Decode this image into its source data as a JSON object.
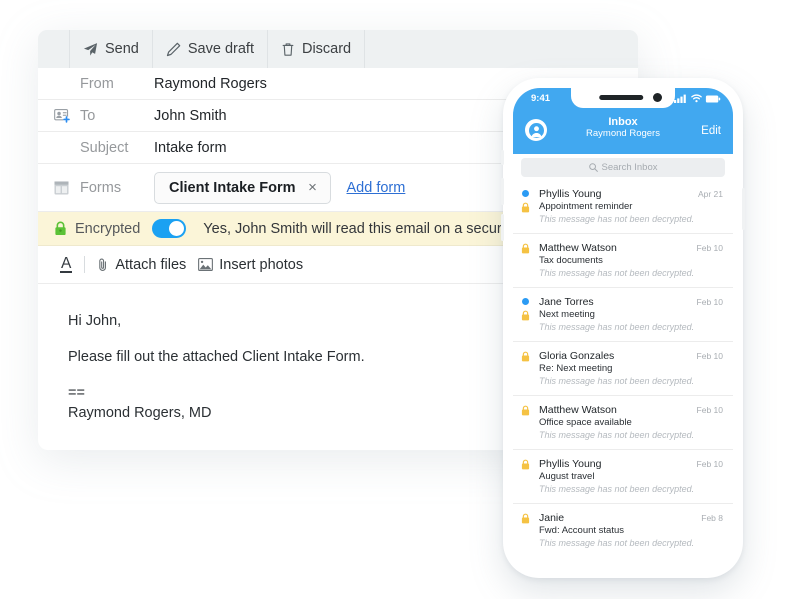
{
  "compose": {
    "toolbar": [
      {
        "id": "send",
        "label": "Send",
        "icon": "send-icon"
      },
      {
        "id": "save-draft",
        "label": "Save draft",
        "icon": "pencil-icon"
      },
      {
        "id": "discard",
        "label": "Discard",
        "icon": "trash-icon"
      }
    ],
    "fields": {
      "from_label": "From",
      "from_value": "Raymond Rogers",
      "to_label": "To",
      "to_value": "John Smith",
      "subject_label": "Subject",
      "subject_value": "Intake form",
      "forms_label": "Forms",
      "form_chip": "Client Intake Form",
      "form_chip_remove": "×",
      "add_form": "Add form"
    },
    "encrypted": {
      "label": "Encrypted",
      "toggle_on": true,
      "message": "Yes, John Smith will read this email on a secure web page"
    },
    "format_bar": {
      "font_label": "A",
      "attach_label": "Attach files",
      "photos_label": "Insert photos"
    },
    "body": {
      "greeting": "Hi John,",
      "paragraph": "Please fill out the attached Client Intake Form.",
      "separator": "==",
      "signature": "Raymond Rogers, MD"
    }
  },
  "phone": {
    "status": {
      "time": "9:41"
    },
    "nav": {
      "title": "Inbox",
      "subtitle": "Raymond Rogers",
      "edit": "Edit"
    },
    "search": {
      "placeholder": "Search Inbox"
    },
    "preview_text": "This message has not been decrypted.",
    "messages": [
      {
        "from": "Phyllis Young",
        "subject": "Appointment reminder",
        "date": "Apr 21",
        "preview": "This message has not been decrypted.",
        "unread": true
      },
      {
        "from": "Matthew Watson",
        "subject": "Tax documents",
        "date": "Feb 10",
        "preview": "This message has not been decrypted.",
        "unread": false
      },
      {
        "from": "Jane Torres",
        "subject": "Next meeting",
        "date": "Feb 10",
        "preview": "This message has not been decrypted.",
        "unread": true
      },
      {
        "from": "Gloria Gonzales",
        "subject": "Re: Next meeting",
        "date": "Feb 10",
        "preview": "This message has not been decrypted.",
        "unread": false
      },
      {
        "from": "Matthew Watson",
        "subject": "Office space available",
        "date": "Feb 10",
        "preview": "This message has not been decrypted.",
        "unread": false
      },
      {
        "from": "Phyllis Young",
        "subject": "August travel",
        "date": "Feb 10",
        "preview": "This message has not been decrypted.",
        "unread": false
      },
      {
        "from": "Janie",
        "subject": "Fwd: Account status",
        "date": "Feb 8",
        "preview": "This message has not been decrypted.",
        "unread": false
      }
    ]
  },
  "colors": {
    "accent_blue": "#41a8f0",
    "toggle_blue": "#1ba1f2",
    "link_blue": "#2d6fd4",
    "banner_yellow": "#fbf5d8",
    "lock_green": "#5bc236",
    "lock_amber": "#f5c243",
    "unread_dot": "#2b9bf4",
    "toolbar_gray": "#eef1f2"
  }
}
